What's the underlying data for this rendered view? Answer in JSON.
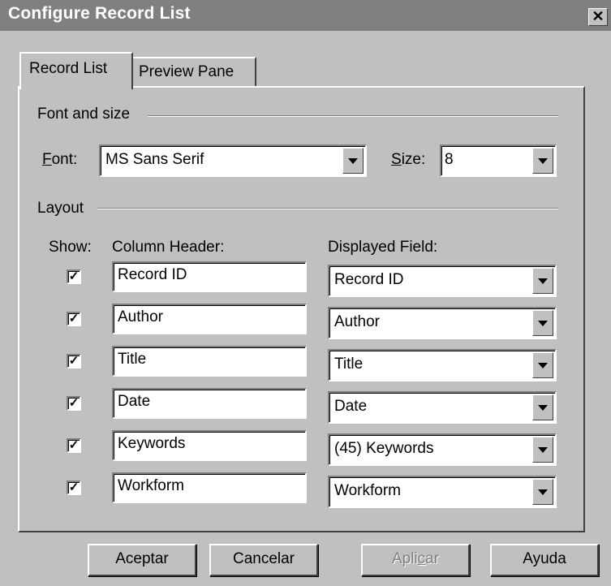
{
  "window": {
    "title": "Configure Record List",
    "close_glyph": "✕"
  },
  "tabs": [
    {
      "label": "Record List"
    },
    {
      "label": "Preview Pane"
    }
  ],
  "font_group": {
    "heading": "Font and size",
    "font_label_hotkey": "F",
    "font_label_rest": "ont:",
    "font_value": "MS Sans Serif",
    "size_label_hotkey": "S",
    "size_label_rest": "ize:",
    "size_value": "8"
  },
  "layout_group": {
    "heading": "Layout",
    "show_header": "Show:",
    "column_header_header": "Column Header:",
    "displayed_field_header": "Displayed Field:",
    "rows": [
      {
        "checked": "✓",
        "column_header": "Record ID",
        "displayed_field": "Record ID"
      },
      {
        "checked": "✓",
        "column_header": "Author",
        "displayed_field": "Author"
      },
      {
        "checked": "✓",
        "column_header": "Title",
        "displayed_field": "Title"
      },
      {
        "checked": "✓",
        "column_header": "Date",
        "displayed_field": "Date"
      },
      {
        "checked": "✓",
        "column_header": "Keywords",
        "displayed_field": "(45) Keywords"
      },
      {
        "checked": "✓",
        "column_header": "Workform",
        "displayed_field": "Workform"
      }
    ]
  },
  "buttons": {
    "accept": "Aceptar",
    "cancel": "Cancelar",
    "apply_before": "Apli",
    "apply_hotkey": "c",
    "apply_after": "ar",
    "help": "Ayuda"
  },
  "colors": {
    "face": "#c0c0c0",
    "titlebar": "#808080",
    "disabled_text": "#808080"
  }
}
